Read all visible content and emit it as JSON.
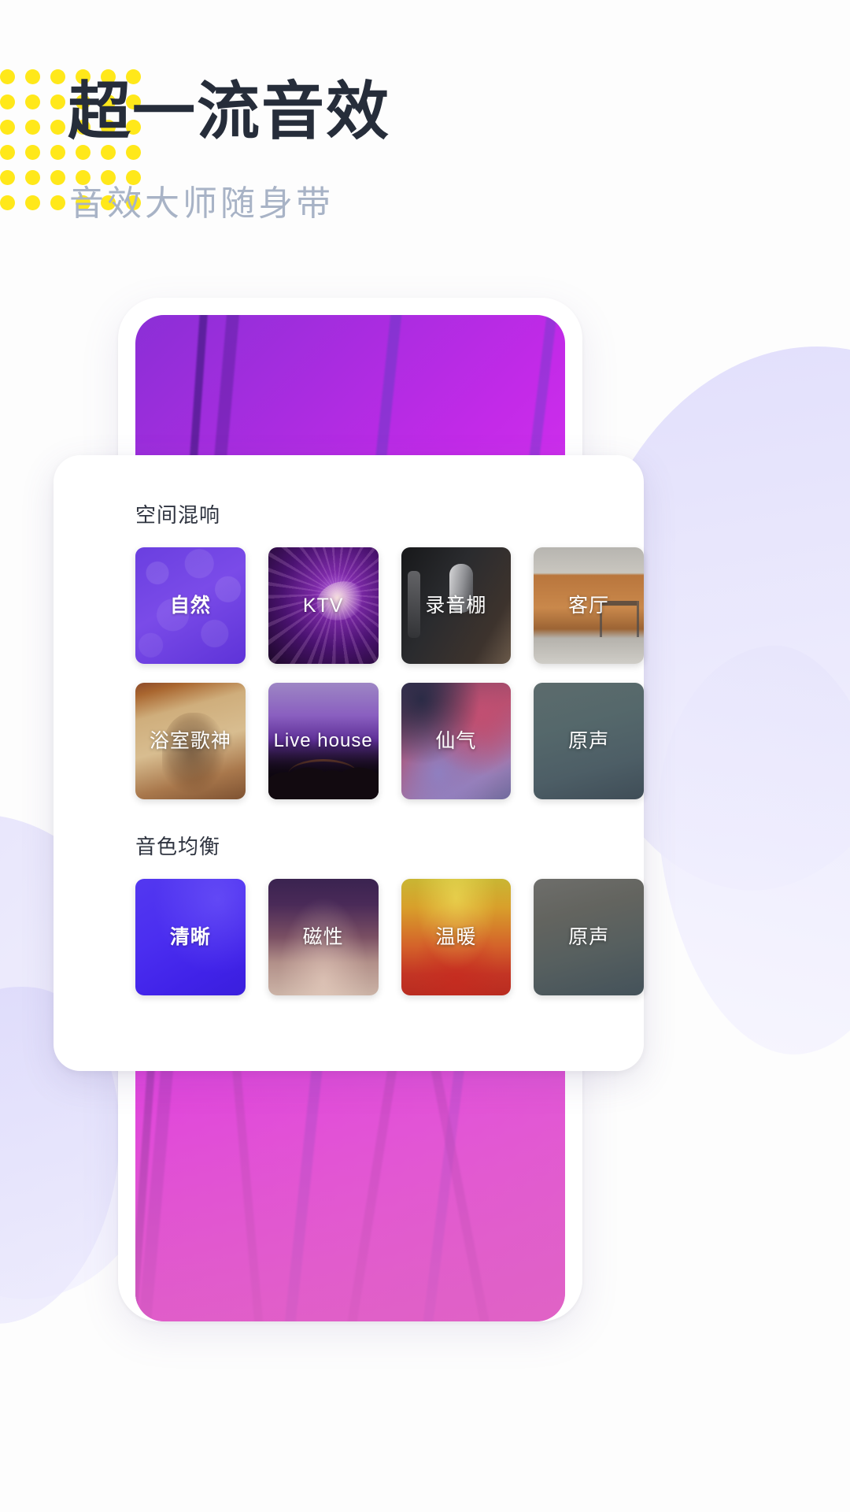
{
  "hero": {
    "headline": "超一流音效",
    "subheadline": "音效大师随身带",
    "dot_color": "#FFE81A",
    "headline_color": "#262D3A",
    "subheadline_color": "#A8B3C6"
  },
  "panel": {
    "sections": [
      {
        "title": "空间混响",
        "rows": [
          [
            {
              "label": "自然",
              "selected": true,
              "art": "art-natural"
            },
            {
              "label": "KTV",
              "selected": false,
              "art": "art-ktv"
            },
            {
              "label": "录音棚",
              "selected": false,
              "art": "art-studio"
            },
            {
              "label": "客厅",
              "selected": false,
              "art": "art-living"
            }
          ],
          [
            {
              "label": "浴室歌神",
              "selected": false,
              "art": "art-bath"
            },
            {
              "label": "Live house",
              "selected": false,
              "art": "art-live"
            },
            {
              "label": "仙气",
              "selected": false,
              "art": "art-fairy"
            },
            {
              "label": "原声",
              "selected": false,
              "art": "art-origin-r"
            }
          ]
        ]
      },
      {
        "title": "音色均衡",
        "rows": [
          [
            {
              "label": "清晰",
              "selected": true,
              "art": "art-clear"
            },
            {
              "label": "磁性",
              "selected": false,
              "art": "art-magnetic"
            },
            {
              "label": "温暖",
              "selected": false,
              "art": "art-warm"
            },
            {
              "label": "原声",
              "selected": false,
              "art": "art-origin-e"
            }
          ]
        ]
      }
    ]
  },
  "phone": {
    "wallpaper_colors": [
      "#8B2FD6",
      "#C32AE8",
      "#DF36F2",
      "#E06FD3"
    ]
  },
  "background": {
    "page_color": "#FDFDFD",
    "blob_color": "#E3E0FB"
  }
}
